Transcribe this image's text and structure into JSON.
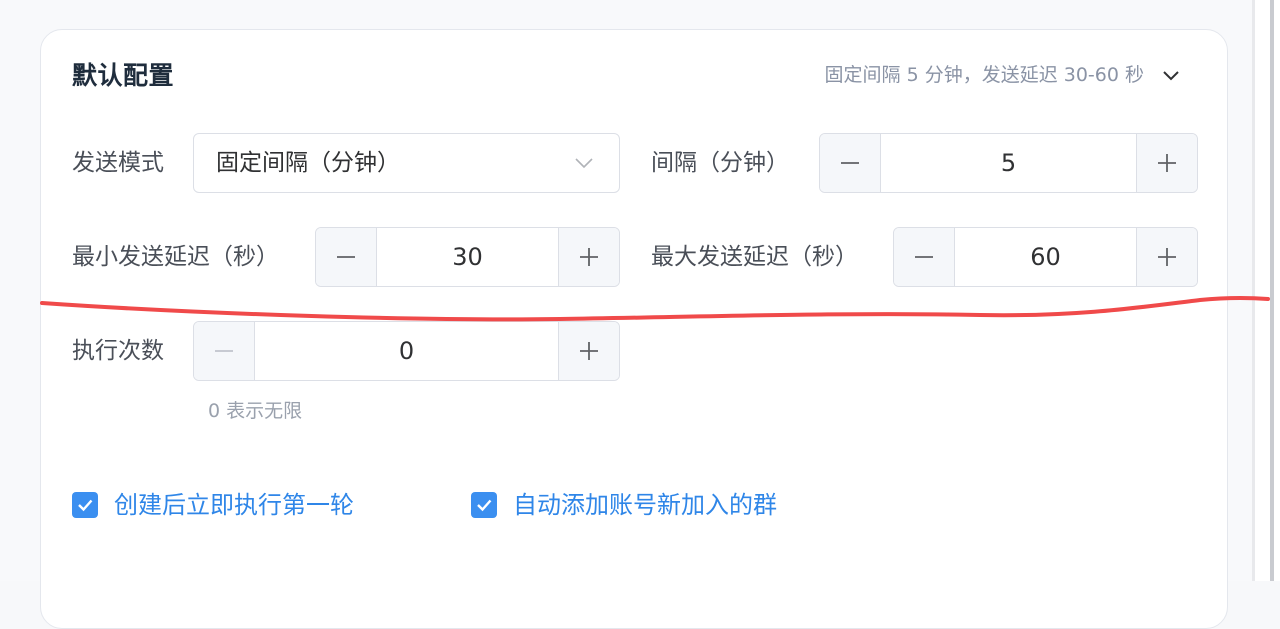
{
  "panel": {
    "title": "默认配置",
    "summary": "固定间隔 5 分钟，发送延迟 30-60 秒"
  },
  "send_mode": {
    "label": "发送模式",
    "value": "固定间隔（分钟）"
  },
  "interval": {
    "label": "间隔（分钟）",
    "value": "5",
    "minus": "−",
    "plus": "+"
  },
  "min_delay": {
    "label": "最小发送延迟（秒）",
    "value": "30",
    "minus": "−",
    "plus": "+"
  },
  "max_delay": {
    "label": "最大发送延迟（秒）",
    "value": "60",
    "minus": "−",
    "plus": "+"
  },
  "run_count": {
    "label": "执行次数",
    "value": "0",
    "minus": "−",
    "plus": "+",
    "hint": "0 表示无限"
  },
  "options": {
    "run_first_round": {
      "label": "创建后立即执行第一轮",
      "checked": true
    },
    "auto_add_groups": {
      "label": "自动添加账号新加入的群",
      "checked": true
    }
  },
  "colors": {
    "accent": "#3b8ff0",
    "annotation": "#f04a4a"
  },
  "icons": {
    "header_toggle": "chevron-down-icon",
    "select_arrow": "chevron-down-icon",
    "checkbox": "check-icon"
  }
}
